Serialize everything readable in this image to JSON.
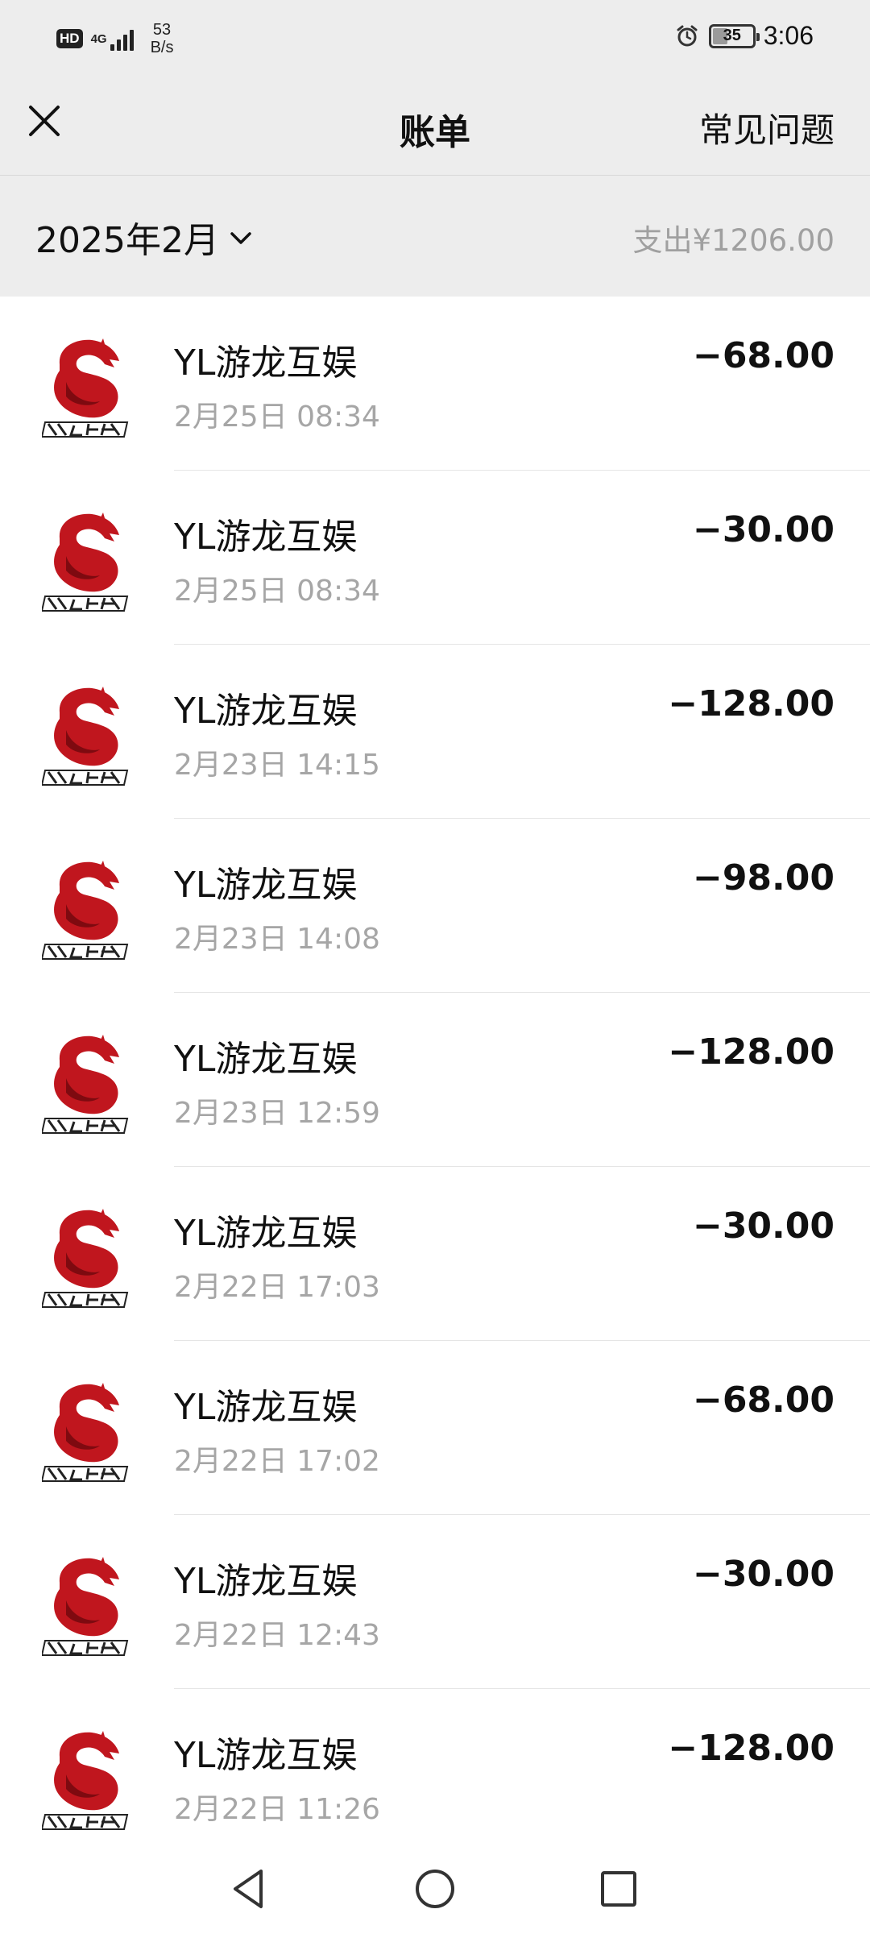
{
  "status_bar": {
    "hd": "HD",
    "network": "4G",
    "speed_value": "53",
    "speed_unit": "B/s",
    "battery": "35",
    "battery_fraction": 0.35,
    "time": "3:06",
    "icons": [
      "alarm-icon",
      "battery-icon",
      "signal-icon"
    ]
  },
  "header": {
    "title": "账单",
    "faq": "常见问题",
    "close_icon": "close-icon"
  },
  "filter": {
    "month": "2025年2月",
    "expense": "支出¥1206.00"
  },
  "transactions": [
    {
      "merchant": "YL游龙互娱",
      "time": "2月25日 08:34",
      "amount": "−68.00"
    },
    {
      "merchant": "YL游龙互娱",
      "time": "2月25日 08:34",
      "amount": "−30.00"
    },
    {
      "merchant": "YL游龙互娱",
      "time": "2月23日 14:15",
      "amount": "−128.00"
    },
    {
      "merchant": "YL游龙互娱",
      "time": "2月23日 14:08",
      "amount": "−98.00"
    },
    {
      "merchant": "YL游龙互娱",
      "time": "2月23日 12:59",
      "amount": "−128.00"
    },
    {
      "merchant": "YL游龙互娱",
      "time": "2月22日 17:03",
      "amount": "−30.00"
    },
    {
      "merchant": "YL游龙互娱",
      "time": "2月22日 17:02",
      "amount": "−68.00"
    },
    {
      "merchant": "YL游龙互娱",
      "time": "2月22日 12:43",
      "amount": "−30.00"
    },
    {
      "merchant": "YL游龙互娱",
      "time": "2月22日 11:26",
      "amount": "−128.00"
    }
  ],
  "colors": {
    "background": "#ededed",
    "list_background": "#ffffff",
    "logo_red": "#c0161e",
    "muted_text": "#a6a6a6"
  },
  "system_nav": {
    "back": "back-triangle-icon",
    "home": "home-circle-icon",
    "recent": "recent-square-icon"
  }
}
